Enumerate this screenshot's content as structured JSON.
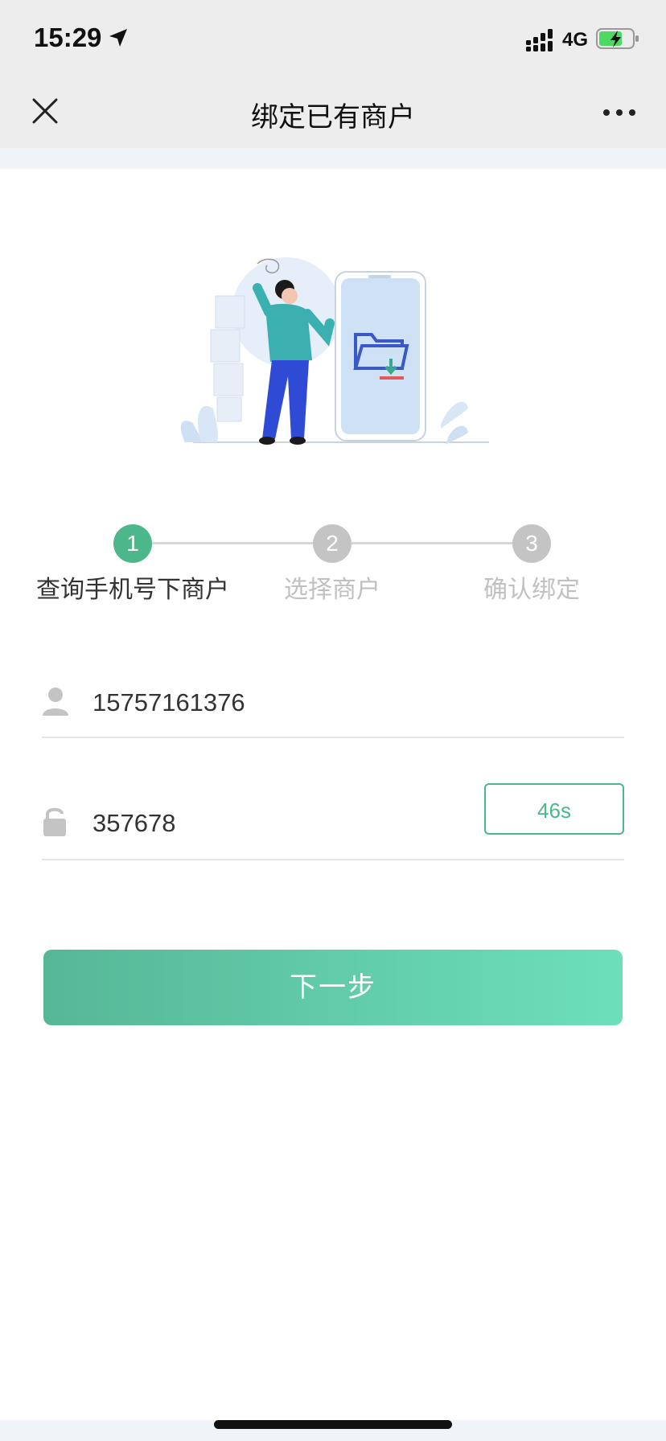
{
  "status_bar": {
    "time": "15:29",
    "network": "4G",
    "icons": [
      "location-arrow-icon",
      "signal-icon",
      "battery-charging-icon"
    ]
  },
  "nav": {
    "title": "绑定已有商户",
    "left_icon": "close-icon",
    "right_icon": "more-icon"
  },
  "illustration": {
    "description_icon": "person-phone-folder-illustration"
  },
  "steps": [
    {
      "number": "1",
      "label": "查询手机号下商户",
      "state": "active"
    },
    {
      "number": "2",
      "label": "选择商户",
      "state": "pending"
    },
    {
      "number": "3",
      "label": "确认绑定",
      "state": "pending"
    }
  ],
  "form": {
    "phone": {
      "value": "15757161376",
      "icon": "user-icon"
    },
    "code": {
      "value": "357678",
      "icon": "lock-icon",
      "button_label": "46s"
    }
  },
  "actions": {
    "next_label": "下一步"
  },
  "colors": {
    "accent": "#4db78c",
    "gradient_start": "#56b797",
    "gradient_end": "#6ddfbb",
    "pending": "#c4c4c4",
    "nav_bg": "#ededed"
  }
}
